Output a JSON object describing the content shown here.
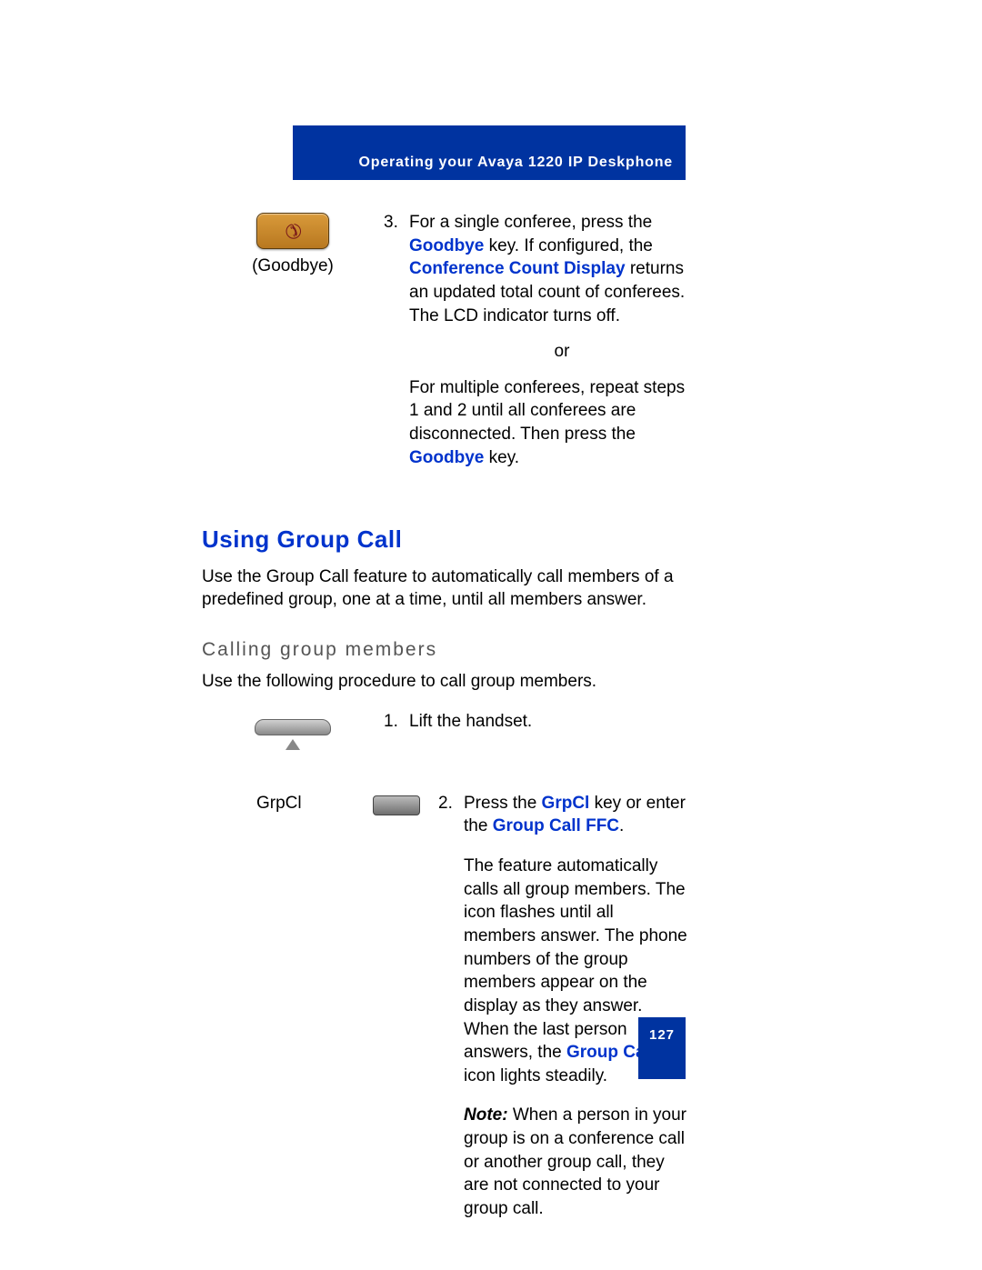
{
  "header": {
    "text": "Operating your Avaya 1220 IP Deskphone"
  },
  "step3": {
    "caption": "(Goodbye)",
    "num": "3.",
    "line1a": "For a single conferee, press the ",
    "goodbye": "Goodbye",
    "line1b": " key. If configured, the ",
    "ccd": "Conference Count Display",
    "line1c": " returns an updated total count of conferees. The LCD indicator turns off.",
    "or": "or",
    "line2a": "For multiple conferees, repeat steps 1 and 2 until all conferees are disconnected. Then press the ",
    "line2b": " key."
  },
  "section": {
    "heading": "Using Group Call",
    "intro": "Use the Group Call feature to automatically call members of a predefined group, one at a time, until all members answer.",
    "sub": "Calling group members",
    "subintro": "Use the following procedure to call group members."
  },
  "step1": {
    "num": "1.",
    "text": "Lift the handset."
  },
  "step2": {
    "label": "GrpCl",
    "num": "2.",
    "a": "Press the ",
    "grpcl": "GrpCl",
    "b": " key or enter the ",
    "gcffc": "Group Call FFC",
    "c": ".",
    "p2a": "The feature automatically calls all group members. The icon flashes until all members answer. The phone numbers of the group members appear on the display as they answer. When the last person answers, the ",
    "gc": "Group Call",
    "p2b": " icon lights steadily.",
    "noteLabel": "Note:",
    "noteText": " When a person in your group is on a conference call or another group call, they are not connected to your group call."
  },
  "pageNumber": "127"
}
